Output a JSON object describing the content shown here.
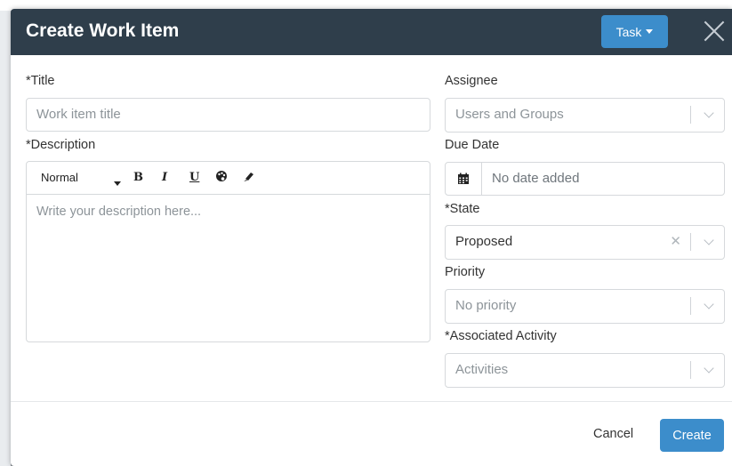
{
  "modal": {
    "title": "Create Work Item",
    "type_button": "Task"
  },
  "form": {
    "title_label": "*Title",
    "title_placeholder": "Work item title",
    "description_label": "*Description",
    "editor": {
      "format_select": "Normal",
      "bold": "B",
      "italic": "I",
      "underline": "U",
      "placeholder": "Write your description here..."
    },
    "assignee_label": "Assignee",
    "assignee_placeholder": "Users and Groups",
    "due_date_label": "Due Date",
    "due_date_placeholder": "No date added",
    "state_label": "*State",
    "state_value": "Proposed",
    "priority_label": "Priority",
    "priority_placeholder": "No priority",
    "activity_label": "*Associated Activity",
    "activity_placeholder": "Activities"
  },
  "footer": {
    "cancel": "Cancel",
    "create": "Create"
  },
  "colors": {
    "header_bg": "#2f3e4b",
    "accent": "#3c8dcb"
  }
}
